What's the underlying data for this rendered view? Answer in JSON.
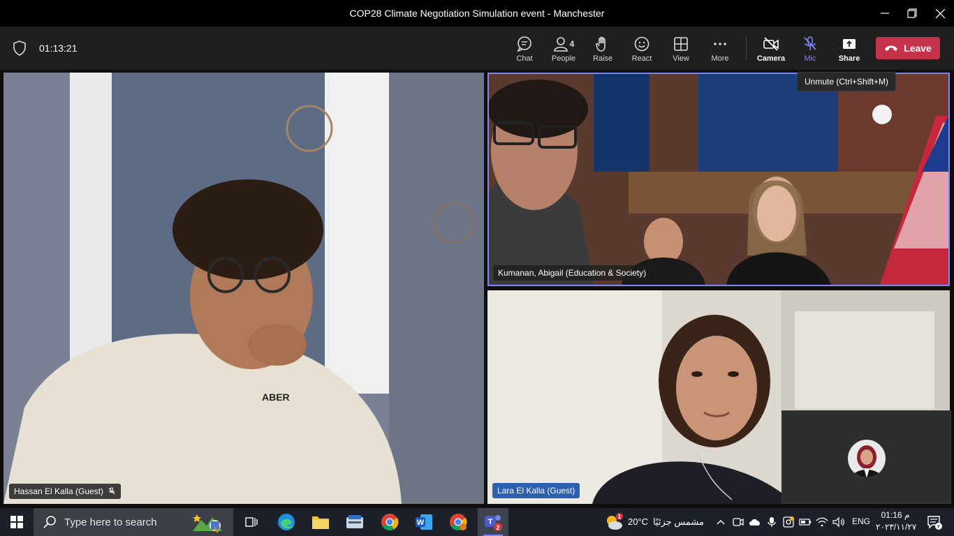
{
  "window": {
    "title": "COP28 Climate Negotiation Simulation event - Manchester"
  },
  "toolbar": {
    "timer": "01:13:21",
    "chat_label": "Chat",
    "people_label": "People",
    "people_count": "4",
    "raise_label": "Raise",
    "react_label": "React",
    "view_label": "View",
    "more_label": "More",
    "camera_label": "Camera",
    "mic_label": "Mic",
    "share_label": "Share",
    "leave_label": "Leave"
  },
  "tooltip": {
    "text": "Unmute (Ctrl+Shift+M)"
  },
  "participants": [
    {
      "name": "Hassan El Kalla (Guest)",
      "muted": true
    },
    {
      "name": "Kumanan, Abigail (Education & Society)",
      "active_speaker": true
    },
    {
      "name": "Lara El Kalla (Guest)"
    }
  ],
  "taskbar": {
    "search_placeholder": "Type here to search",
    "teams_badge": "2",
    "weather_badge": "1",
    "weather_temp": "20°C",
    "weather_desc": "مشمس جزئيًا",
    "language": "ENG",
    "time": "01:16 م",
    "date": "٢٠٢٣/١١/٢٧",
    "notification_count": "٢"
  },
  "colors": {
    "accent": "#7f85f5",
    "leave": "#c4314b",
    "toolbar_bg": "#1f1f1f",
    "taskbar_bg": "#1c2129"
  }
}
